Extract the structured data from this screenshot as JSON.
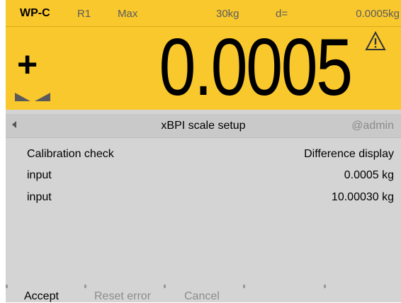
{
  "header": {
    "model": "WP-C",
    "range": "R1",
    "max_label": "Max",
    "max_value": "30kg",
    "d_label": "d=",
    "d_value": "0.0005kg",
    "sign": "+",
    "weight": "0.0005",
    "warning_icon": "warning-triangle-icon",
    "stability_icon": "stability-indicator-icon"
  },
  "nav": {
    "back_icon": "back-arrow-icon",
    "title": "xBPI scale setup",
    "user": "@admin"
  },
  "content": {
    "rows": [
      {
        "label": "Calibration check",
        "value": "Difference display"
      },
      {
        "label": "input",
        "value": "0.0005 kg"
      },
      {
        "label": "input",
        "value": "10.00030 kg"
      }
    ]
  },
  "softkeys": {
    "accept": "Accept",
    "reset_error": "Reset error",
    "cancel": "Cancel"
  },
  "colors": {
    "header_bg": "#f9c82d",
    "screen_bg": "#d4d4d4",
    "nav_bg": "#c9c9c9"
  }
}
